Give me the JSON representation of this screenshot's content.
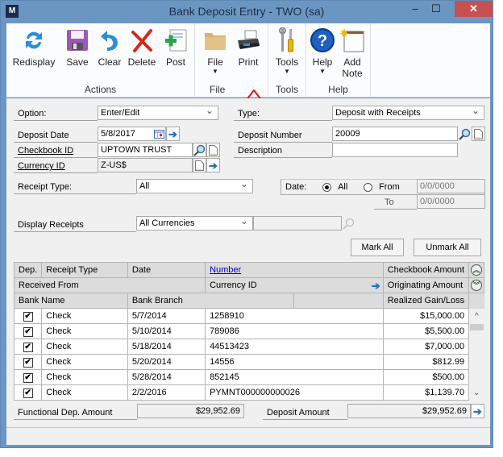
{
  "window": {
    "title": "Bank Deposit Entry  -  TWO (sa)",
    "controls": {
      "minimize": "–",
      "maximize": "☐",
      "close": "✕"
    }
  },
  "ribbon": {
    "groups": [
      {
        "label": "Actions",
        "buttons": [
          {
            "label": "Redisplay",
            "icon": "redisplay-icon"
          },
          {
            "label": "Save",
            "icon": "save-icon"
          },
          {
            "label": "Clear",
            "icon": "clear-icon"
          },
          {
            "label": "Delete",
            "icon": "delete-icon"
          },
          {
            "label": "Post",
            "icon": "post-icon"
          }
        ]
      },
      {
        "label": "File",
        "buttons": [
          {
            "label": "File",
            "icon": "folder-icon",
            "dropdown": true
          },
          {
            "label": "Print",
            "icon": "printer-icon"
          }
        ]
      },
      {
        "label": "Tools",
        "buttons": [
          {
            "label": "Tools",
            "icon": "tools-icon",
            "dropdown": true
          }
        ]
      },
      {
        "label": "Help",
        "buttons": [
          {
            "label": "Help",
            "icon": "help-icon",
            "dropdown": true
          },
          {
            "label": "Add",
            "label2": "Note",
            "icon": "note-icon"
          }
        ]
      }
    ],
    "caret": "▼"
  },
  "annotation": {
    "arrow_color": "#e0141e"
  },
  "form": {
    "option": {
      "label": "Option:",
      "value": "Enter/Edit"
    },
    "type": {
      "label": "Type:",
      "value": "Deposit with Receipts"
    },
    "deposit_date": {
      "label": "Deposit Date",
      "value": "5/8/2017"
    },
    "deposit_number": {
      "label": "Deposit Number",
      "value": "20009"
    },
    "checkbook_id": {
      "label": "Checkbook ID",
      "value": "UPTOWN TRUST"
    },
    "description": {
      "label": "Description",
      "value": ""
    },
    "currency_id": {
      "label": "Currency ID",
      "value": "Z-US$"
    },
    "receipt_type": {
      "label": "Receipt Type:",
      "value": "All"
    },
    "date_filter": {
      "label": "Date:",
      "all_label": "All",
      "from_label": "From",
      "to_label": "To",
      "selected": "All",
      "from_value": "0/0/0000",
      "to_value": "0/0/0000"
    },
    "display_receipts": {
      "label": "Display Receipts",
      "value": "All Currencies",
      "extra": ""
    },
    "mark_all": "Mark All",
    "unmark_all": "Unmark All"
  },
  "grid": {
    "headers": {
      "row1": [
        "Dep.",
        "Receipt Type",
        "Date",
        "Number",
        "Checkbook Amount"
      ],
      "row2": [
        "Received From",
        "Currency ID",
        "Originating Amount"
      ],
      "row3": [
        "Bank Name",
        "Bank Branch",
        "",
        "Realized Gain/Loss"
      ]
    },
    "rows": [
      {
        "dep": true,
        "type": "Check",
        "date": "5/7/2014",
        "number": "1258910",
        "amount": "$15,000.00"
      },
      {
        "dep": true,
        "type": "Check",
        "date": "5/10/2014",
        "number": "789086",
        "amount": "$5,500.00"
      },
      {
        "dep": true,
        "type": "Check",
        "date": "5/18/2014",
        "number": "44513423",
        "amount": "$7,000.00"
      },
      {
        "dep": true,
        "type": "Check",
        "date": "5/20/2014",
        "number": "14556",
        "amount": "$812.99"
      },
      {
        "dep": true,
        "type": "Check",
        "date": "5/28/2014",
        "number": "852145",
        "amount": "$500.00"
      },
      {
        "dep": true,
        "type": "Check",
        "date": "2/2/2016",
        "number": "PYMNT000000000026",
        "amount": "$1,139.70"
      }
    ],
    "check_glyph": "✔",
    "scroll_up": "^",
    "scroll_down": "⌄",
    "expand": "︽",
    "collapse": "︾"
  },
  "totals": {
    "functional_label": "Functional Dep. Amount",
    "functional_value": "$29,952.69",
    "deposit_label": "Deposit Amount",
    "deposit_value": "$29,952.69"
  }
}
